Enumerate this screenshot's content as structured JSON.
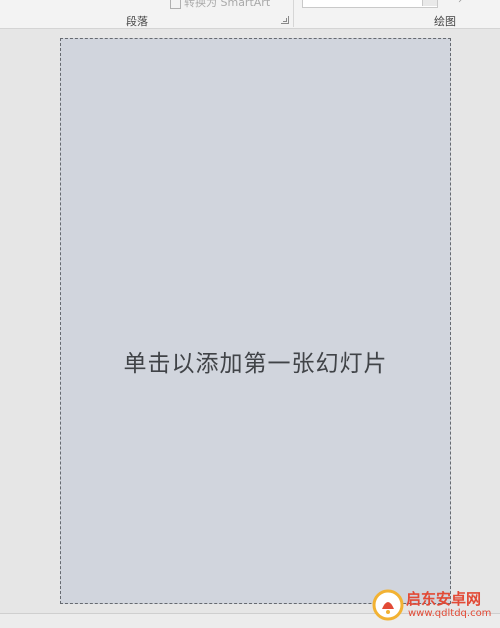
{
  "ribbon": {
    "smartart_text": "转换为 SmartArt",
    "paragraph_group_label": "段落",
    "drawing_group_label": "绘图"
  },
  "slide": {
    "placeholder_text": "单击以添加第一张幻灯片",
    "background_color": "#d1d5dd"
  },
  "watermark": {
    "title": "启东安卓网",
    "url": "www.qdltdq.com",
    "color": "#e24a36"
  }
}
